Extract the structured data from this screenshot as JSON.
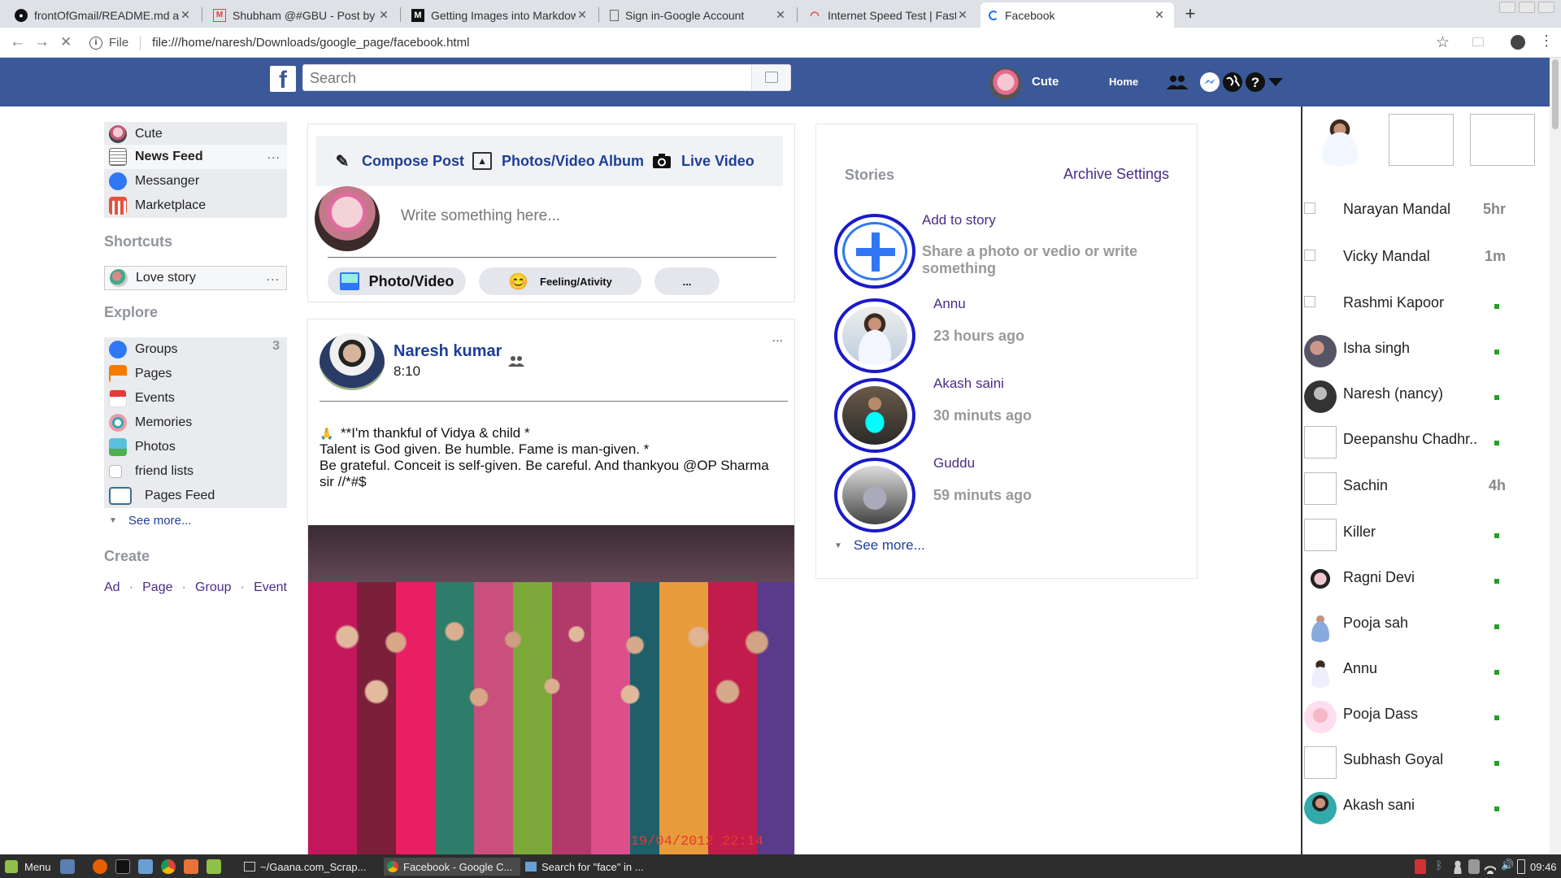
{
  "browser": {
    "tabs": [
      {
        "title": "frontOfGmail/README.md at m",
        "icon": "github-icon"
      },
      {
        "title": "Shubham @#GBU - Post by Sun",
        "icon": "gmail-icon"
      },
      {
        "title": "Getting Images into Markdown",
        "icon": "medium-icon"
      },
      {
        "title": "Sign in-Google Account",
        "icon": "page-icon"
      },
      {
        "title": "Internet Speed Test | Fast.com",
        "icon": "fast-icon"
      },
      {
        "title": "Facebook",
        "icon": "loading-icon",
        "active": true
      }
    ],
    "url_scheme": "File",
    "url": "file:///home/naresh/Downloads/google_page/facebook.html"
  },
  "header": {
    "logo": "f",
    "search_placeholder": "Search",
    "user_name": "Cute",
    "home_label": "Home"
  },
  "left_sidebar": {
    "items": [
      {
        "label": "Cute",
        "icon": "profile-avatar"
      },
      {
        "label": "News Feed",
        "icon": "news-feed-icon",
        "more": "..."
      },
      {
        "label": "Messanger",
        "icon": "messenger-icon"
      },
      {
        "label": "Marketplace",
        "icon": "marketplace-icon"
      }
    ],
    "shortcuts_heading": "Shortcuts",
    "shortcut": {
      "label": "Love story",
      "more": "..."
    },
    "explore_heading": "Explore",
    "explore": [
      {
        "label": "Groups",
        "count": "3",
        "icon": "groups-icon"
      },
      {
        "label": "Pages",
        "icon": "flag-icon"
      },
      {
        "label": "Events",
        "icon": "calendar-icon"
      },
      {
        "label": "Memories",
        "icon": "memories-icon"
      },
      {
        "label": "Photos",
        "icon": "photos-icon"
      },
      {
        "label": "friend lists",
        "icon": "broken-image-icon"
      },
      {
        "label": "Pages Feed",
        "icon": "pages-feed-icon"
      }
    ],
    "see_more": "See more...",
    "create_heading": "Create",
    "create_links": [
      "Ad",
      "Page",
      "Group",
      "Event"
    ]
  },
  "composer": {
    "tabs": [
      "Compose Post",
      "Photos/Video Album",
      "Live Video"
    ],
    "placeholder": "Write something here...",
    "buttons": {
      "photo": "Photo/Video",
      "feeling": "Feeling/Ativity",
      "more": "..."
    }
  },
  "post": {
    "author": "Naresh kumar",
    "time": "8:10",
    "more": "...",
    "text_lines": [
      "**I'm thankful of Vidya & child *",
      "Talent is God given. Be humble. Fame is man-given. *",
      "Be grateful. Conceit is self-given. Be careful. And thankyou @OP Sharma sir //*#$"
    ],
    "photo_timestamp": "19/04/2012 22:14"
  },
  "stories": {
    "heading": "Stories",
    "archive_label": "Archive Settings",
    "add_title": "Add to story",
    "add_subtitle": "Share a photo or vedio or write something",
    "items": [
      {
        "name": "Annu",
        "time": "23 hours ago"
      },
      {
        "name": "Akash saini",
        "time": "30 minuts ago"
      },
      {
        "name": "Guddu",
        "time": "59 minuts ago"
      }
    ],
    "see_more": "See more..."
  },
  "contacts": [
    {
      "name": "Narayan Mandal",
      "status": "5hr"
    },
    {
      "name": "Vicky Mandal",
      "status": "1m"
    },
    {
      "name": "Rashmi Kapoor",
      "status": "online"
    },
    {
      "name": "Isha singh",
      "status": "online"
    },
    {
      "name": "Naresh (nancy)",
      "status": "online"
    },
    {
      "name": "Deepanshu Chadhr..",
      "status": "online"
    },
    {
      "name": "Sachin",
      "status": "4h"
    },
    {
      "name": "Killer",
      "status": "online"
    },
    {
      "name": "Ragni Devi",
      "status": "online"
    },
    {
      "name": "Pooja sah",
      "status": "online"
    },
    {
      "name": "Annu",
      "status": "online"
    },
    {
      "name": "Pooja Dass",
      "status": "online"
    },
    {
      "name": "Subhash Goyal",
      "status": "online"
    },
    {
      "name": "Akash sani",
      "status": "online"
    }
  ],
  "taskbar": {
    "menu_label": "Menu",
    "windows": [
      "~/Gaana.com_Scrap...",
      "Facebook - Google C...",
      "Search for \"face\" in ..."
    ],
    "clock": "09:46"
  },
  "colors": {
    "facebook_blue": "#3b5998",
    "link_purple": "#4b2c86",
    "story_ring": "#1a1ac8",
    "online_green": "#2a9d2a"
  }
}
